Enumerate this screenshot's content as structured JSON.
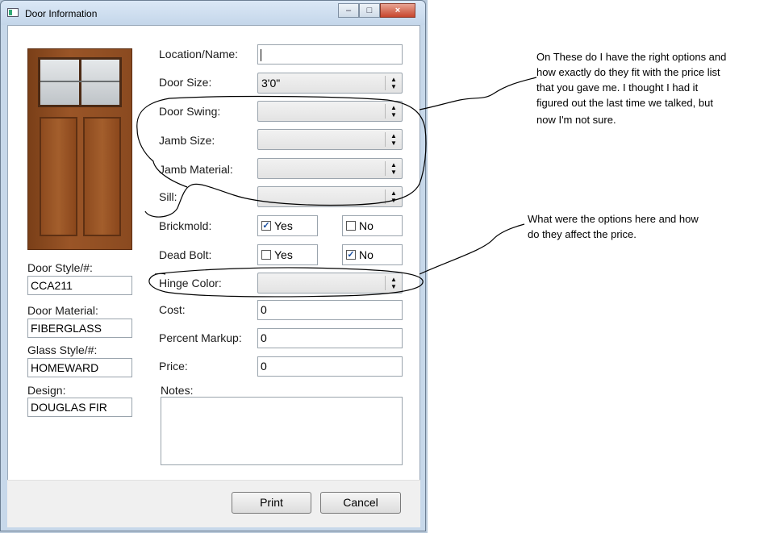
{
  "window": {
    "title": "Door Information",
    "controls": {
      "minimize": "–",
      "maximize": "□",
      "close": "×"
    }
  },
  "left": {
    "door_style_label": "Door Style/#:",
    "door_style_value": "CCA211",
    "door_material_label": "Door Material:",
    "door_material_value": "FIBERGLASS",
    "glass_style_label": "Glass Style/#:",
    "glass_style_value": "HOMEWARD",
    "design_label": "Design:",
    "design_value": "DOUGLAS FIR"
  },
  "form": {
    "location_label": "Location/Name:",
    "location_value": "",
    "door_size_label": "Door Size:",
    "door_size_value": "3'0\"",
    "door_swing_label": "Door Swing:",
    "door_swing_value": "",
    "jamb_size_label": "Jamb Size:",
    "jamb_size_value": "",
    "jamb_material_label": "Jamb Material:",
    "jamb_material_value": "",
    "sill_label": "Sill:",
    "sill_value": "",
    "brickmold_label": "Brickmold:",
    "brickmold_yes": "Yes",
    "brickmold_no": "No",
    "deadbolt_label": "Dead Bolt:",
    "deadbolt_yes": "Yes",
    "deadbolt_no": "No",
    "hinge_color_label": "Hinge Color:",
    "hinge_color_value": "",
    "cost_label": "Cost:",
    "cost_value": "0",
    "markup_label": "Percent Markup:",
    "markup_value": "0",
    "price_label": "Price:",
    "price_value": "0",
    "notes_label": "Notes:",
    "notes_value": ""
  },
  "state": {
    "brickmold": "Yes",
    "deadbolt": "No"
  },
  "buttons": {
    "print": "Print",
    "cancel": "Cancel"
  },
  "annotations": {
    "note1": [
      "On These do I have the right options and",
      "how exactly do they fit with the price list",
      "that you gave me. I thought I had it",
      "figured out the last time we talked, but",
      "now I'm not sure."
    ],
    "note2": [
      "What were the options here and how",
      "do they affect the price."
    ]
  },
  "icons": {
    "dropdown": "updown-arrow-icon",
    "check": "check-icon"
  }
}
